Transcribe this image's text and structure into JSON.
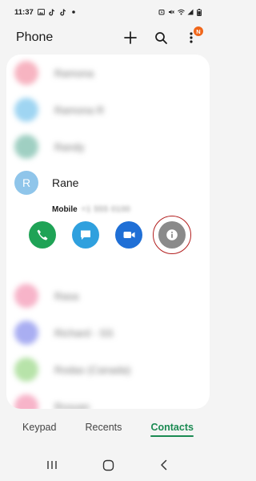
{
  "status_bar": {
    "time": "11:37",
    "left_icons": [
      "gallery-icon",
      "tiktok-icon",
      "tiktok-icon",
      "dot-icon"
    ],
    "right_icons": [
      "alarm-icon",
      "mute-icon",
      "wifi-icon",
      "signal-icon",
      "battery-icon"
    ]
  },
  "header": {
    "title": "Phone",
    "badge": "N"
  },
  "blurred_top": [
    {
      "name": "Ramona",
      "color": "#f7b4c1"
    },
    {
      "name": "Ramona R",
      "color": "#9fd5f2"
    },
    {
      "name": "Randy",
      "color": "#9fcfc2"
    }
  ],
  "expanded_contact": {
    "initial": "R",
    "name": "Rane",
    "number_label": "Mobile",
    "number_hidden": "+1 555 0100"
  },
  "blurred_bottom": [
    {
      "name": "Rasa",
      "color": "#f7b4c9"
    },
    {
      "name": "Richard - SS",
      "color": "#a9aef2"
    },
    {
      "name": "Rodas (Canada)",
      "color": "#b7e3a9"
    },
    {
      "name": "Roxyan",
      "color": "#f7b4c9"
    }
  ],
  "tabs": {
    "keypad": "Keypad",
    "recents": "Recents",
    "contacts": "Contacts"
  },
  "colors": {
    "accent": "#1b8a52",
    "call": "#1fa356",
    "message": "#2fa0de",
    "video": "#1f6fd6",
    "info": "#8a8a8a",
    "highlight_ring": "#b21e1e"
  }
}
